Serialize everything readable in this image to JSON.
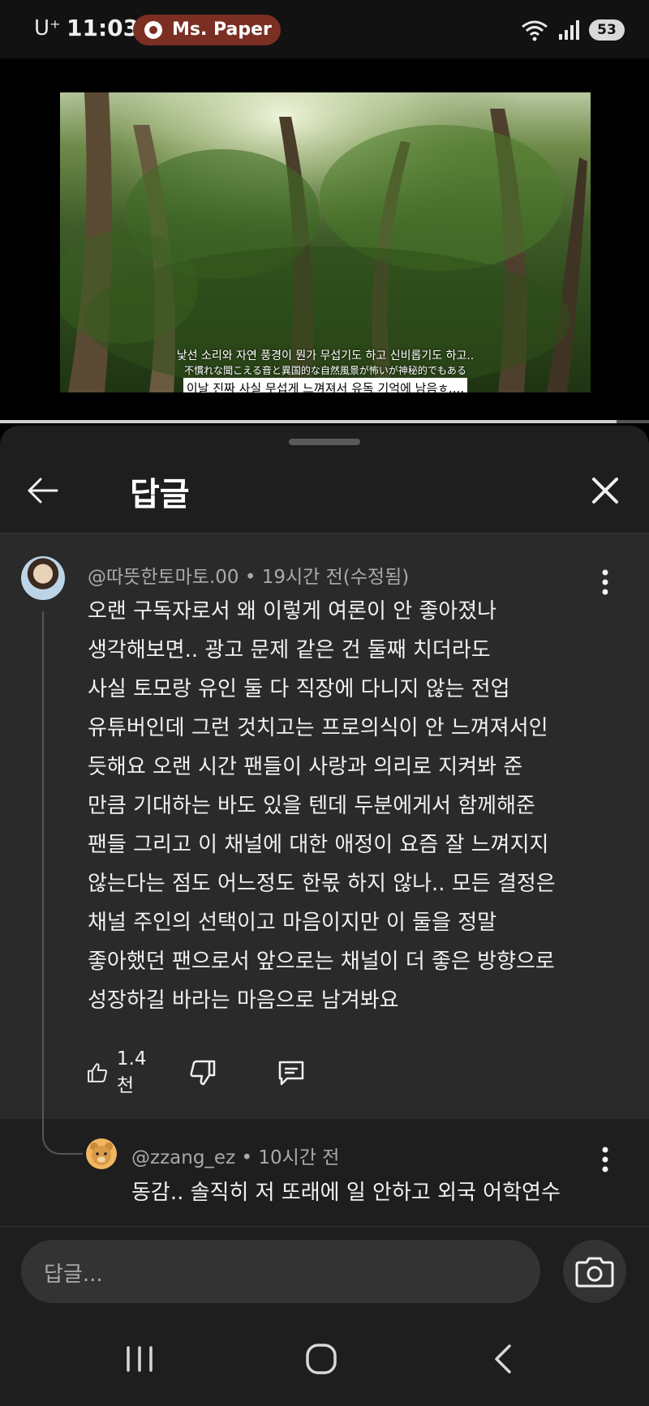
{
  "status_bar": {
    "carrier": "U⁺",
    "time": "11:03",
    "media_app": "Ms. Paper",
    "battery": "53"
  },
  "video": {
    "subtitle_line1": "낯선 소리와 자연 풍경이 뭔가 무섭기도 하고 신비롭기도 하고..",
    "subtitle_line2": "不慣れな聞こえる音と異国的な自然風景が怖いが神秘的でもある",
    "subtitle_line3": "이날 진짜 사실 무섭게 느껴져서 유독 기억에 남음ㅎ....",
    "progress": 0.95
  },
  "panel": {
    "title": "답글"
  },
  "comment": {
    "author_meta": "@따뜻한토마토.00 • 19시간 전(수정됨)",
    "lines": [
      "오랜 구독자로서 왜 이렇게 여론이 안 좋아졌나",
      "생각해보면.. 광고 문제 같은 건 둘째 치더라도",
      "사실 토모랑 유인 둘 다 직장에 다니지 않는 전업",
      "유튜버인데 그런 것치고는 프로의식이 안 느껴져서인",
      "듯해요 오랜 시간 팬들이 사랑과 의리로 지켜봐 준",
      "만큼 기대하는 바도 있을 텐데 두분에게서 함께해준",
      "팬들 그리고 이 채널에 대한 애정이 요즘 잘 느껴지지",
      "않는다는 점도 어느정도 한몫 하지 않나.. 모든 결정은",
      "채널 주인의 선택이고 마음이지만 이 둘을 정말",
      "좋아했던 팬으로서 앞으로는 채널이 더 좋은 방향으로",
      "성장하길 바라는 마음으로 남겨봐요"
    ],
    "likes": "1.4천"
  },
  "reply": {
    "author_meta": "@zzang_ez • 10시간 전",
    "text": "동감.. 솔직히 저 또래에 일 안하고 외국 어학연수"
  },
  "input": {
    "placeholder": "답글..."
  }
}
